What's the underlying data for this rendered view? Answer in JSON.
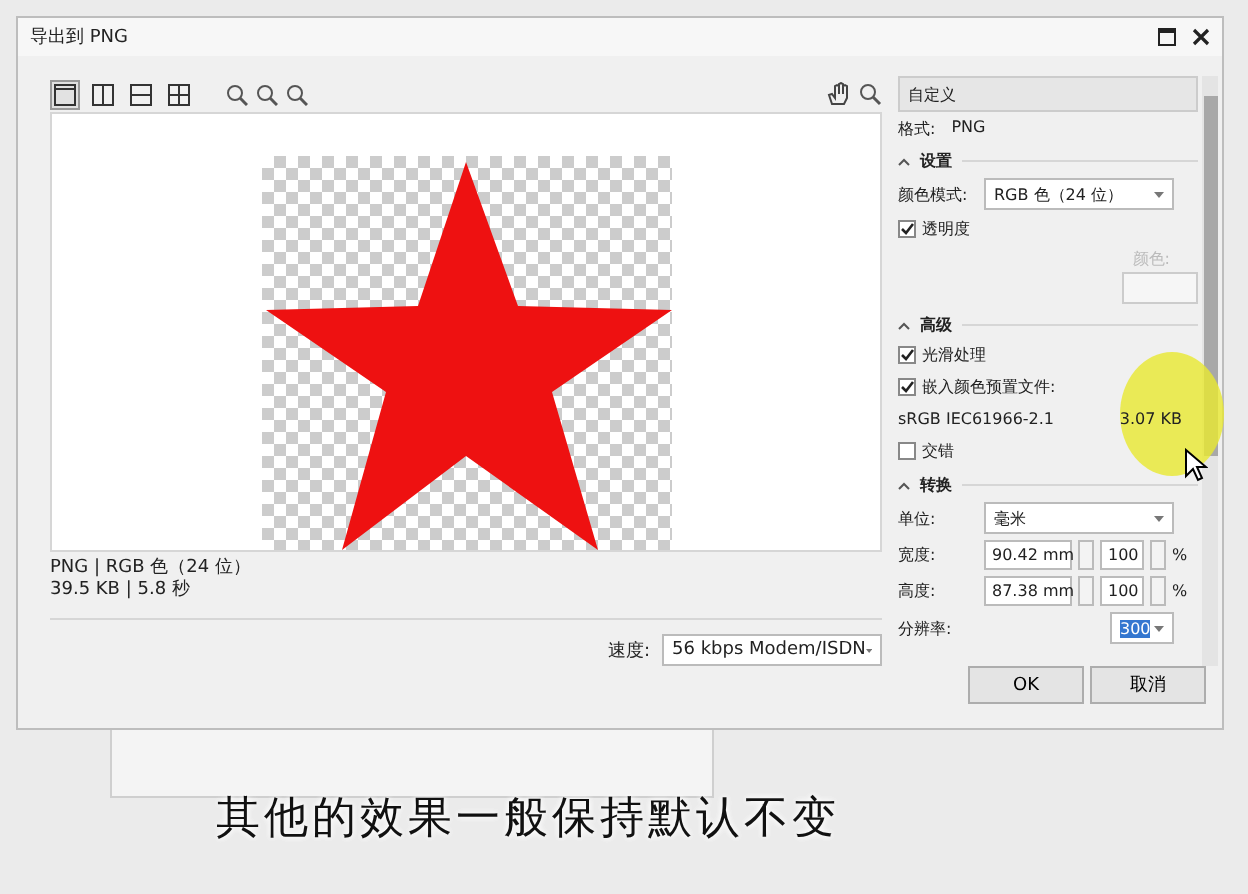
{
  "window": {
    "title": "导出到 PNG"
  },
  "view_buttons": [
    {
      "selected": true
    },
    {
      "selected": false
    },
    {
      "selected": false
    },
    {
      "selected": false
    }
  ],
  "preview": {
    "info": [
      "PNG | RGB 色（24 位）",
      "39.5 KB | 5.8 秒"
    ]
  },
  "speed": {
    "label": "速度:",
    "value": "56 kbps Modem/ISDN"
  },
  "panel": {
    "preset": "自定义",
    "format_label": "格式:",
    "format": "PNG",
    "sections": [
      {
        "title": "设置",
        "expanded": true,
        "rows": [
          {
            "kind": "select",
            "label": "颜色模式:",
            "value": "RGB 色（24 位）"
          },
          {
            "kind": "checkbox",
            "label": "透明度",
            "checked": true
          },
          {
            "kind": "color",
            "label": "颜色:",
            "disabled": true
          }
        ]
      },
      {
        "title": "高级",
        "expanded": true,
        "rows": [
          {
            "kind": "checkbox",
            "label": "光滑处理",
            "checked": true
          },
          {
            "kind": "checkbox",
            "label": "嵌入颜色预置文件:",
            "checked": true
          },
          {
            "kind": "info",
            "label": "sRGB IEC61966-2.1",
            "value": "3.07 KB"
          },
          {
            "kind": "checkbox",
            "label": "交错",
            "checked": false
          }
        ]
      },
      {
        "title": "转换",
        "expanded": true,
        "rows": [
          {
            "kind": "select",
            "label": "单位:",
            "value": "毫米"
          },
          {
            "kind": "size",
            "label": "宽度:",
            "value": "90.42 mm",
            "percent": "100",
            "unit": "%"
          },
          {
            "kind": "size",
            "label": "高度:",
            "value": "87.38 mm",
            "percent": "100",
            "unit": "%"
          },
          {
            "kind": "resolution",
            "label": "分辨率:",
            "value": "300",
            "selected": true
          }
        ]
      }
    ]
  },
  "buttons": [
    "OK",
    "取消"
  ],
  "caption": "其他的效果一般保持默认不变"
}
